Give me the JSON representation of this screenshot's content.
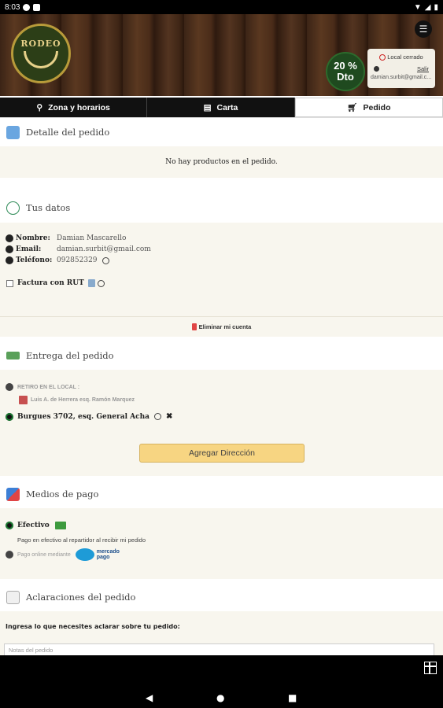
{
  "statusbar": {
    "time": "8:03"
  },
  "header": {
    "brand": "RODEO",
    "discount_line1": "20 %",
    "discount_line2": "Dto",
    "store_status": "Local cerrado",
    "logout_label": "Salir",
    "user_email": "damian.surbit@gmail.c..."
  },
  "tabs": [
    {
      "label": "Zona y horarios",
      "icon": "location-pin-icon"
    },
    {
      "label": "Carta",
      "icon": "menu-book-icon"
    },
    {
      "label": "Pedido",
      "icon": "cart-icon"
    }
  ],
  "order": {
    "title": "Detalle del pedido",
    "empty_message": "No hay productos en el pedido."
  },
  "user_data": {
    "title": "Tus datos",
    "name_label": "Nombre:",
    "name_value": "Damian Mascarello",
    "email_label": "Email:",
    "email_value": "damian.surbit@gmail.com",
    "phone_label": "Teléfono:",
    "phone_value": "092852329",
    "invoice_label": "Factura con RUT",
    "delete_account": "Eliminar mi cuenta"
  },
  "delivery": {
    "title": "Entrega del pedido",
    "pickup_label": "RETIRO EN EL LOCAL :",
    "pickup_address": "Luis A. de Herrera esq. Ramón Marquez",
    "saved_address": "Burgues 3702, esq. General Acha",
    "add_address": "Agregar Dirección"
  },
  "payment": {
    "title": "Medios de pago",
    "cash_label": "Efectivo",
    "cash_desc": "Pago en efectivo al repartidor al recibir mi pedido",
    "online_label": "Pago online mediante",
    "mp_line1": "mercado",
    "mp_line2": "pago"
  },
  "notes": {
    "title": "Aclaraciones del pedido",
    "label": "Ingresa lo que necesites aclarar sobre tu pedido:",
    "placeholder": "Notas del pedido"
  },
  "colors": {
    "panel_bg": "#f8f6ee",
    "button_bg": "#f7d582",
    "discount_bg": "#1f4a1f",
    "selected_radio": "#1b7a32"
  }
}
